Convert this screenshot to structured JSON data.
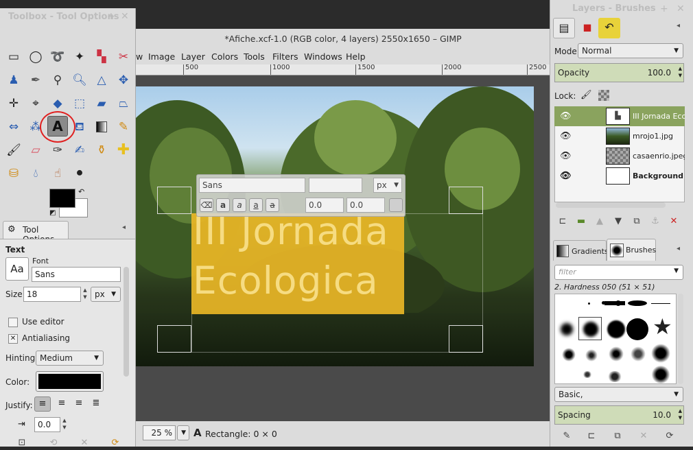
{
  "main_window": {
    "title": "*Afiche.xcf-1.0 (RGB color, 4 layers) 2550x1650 – GIMP",
    "menu": [
      "w",
      "Image",
      "Layer",
      "Colors",
      "Tools",
      "Filters",
      "Windows",
      "Help"
    ],
    "ruler_ticks": [
      "500",
      "1000",
      "1500",
      "2000",
      "2500"
    ],
    "canvas_text_line1": "III Jornada",
    "canvas_text_line2": "Ecologica",
    "text_style_editor": {
      "font": "Sans",
      "size": "",
      "unit": "px",
      "baseline": "0.0",
      "kerning": "0.0"
    },
    "statusbar": {
      "zoom": "25 %",
      "message": "Rectangle: 0 × 0"
    }
  },
  "toolbox": {
    "title": "Toolbox - Tool Options",
    "tool_options_tab": "Tool Options",
    "section": "Text",
    "font_label": "Font",
    "font_value": "Sans",
    "font_preview": "Aa",
    "size_label": "Size:",
    "size_value": "18",
    "size_unit": "px",
    "use_editor": "Use editor",
    "use_editor_checked": false,
    "antialiasing": "Antialiasing",
    "antialiasing_checked": true,
    "hinting_label": "Hinting:",
    "hinting_value": "Medium",
    "color_label": "Color:",
    "text_color": "#000000",
    "justify_label": "Justify:",
    "indent_value": "0.0"
  },
  "right_dock": {
    "title": "Layers - Brushes",
    "mode_label": "Mode:",
    "mode_value": "Normal",
    "opacity_label": "Opacity",
    "opacity_value": "100.0",
    "lock_label": "Lock:",
    "layers": [
      {
        "name": "III Jornada Ecologica",
        "selected": true,
        "bold": false
      },
      {
        "name": "mrojo1.jpg",
        "selected": false,
        "bold": false
      },
      {
        "name": "casaenrio.jpeg",
        "selected": false,
        "bold": false
      },
      {
        "name": "Background",
        "selected": false,
        "bold": true
      }
    ],
    "tabs": [
      "Gradients",
      "Brushes"
    ],
    "filter_placeholder": "filter",
    "brush_name": "2. Hardness 050 (51 × 51)",
    "brush_tag": "Basic,",
    "spacing_label": "Spacing",
    "spacing_value": "10.0"
  },
  "colors": {
    "accent_selected_layer": "#8aa35e",
    "text_box": "#e9b626",
    "text_fill": "#f6dc82"
  }
}
